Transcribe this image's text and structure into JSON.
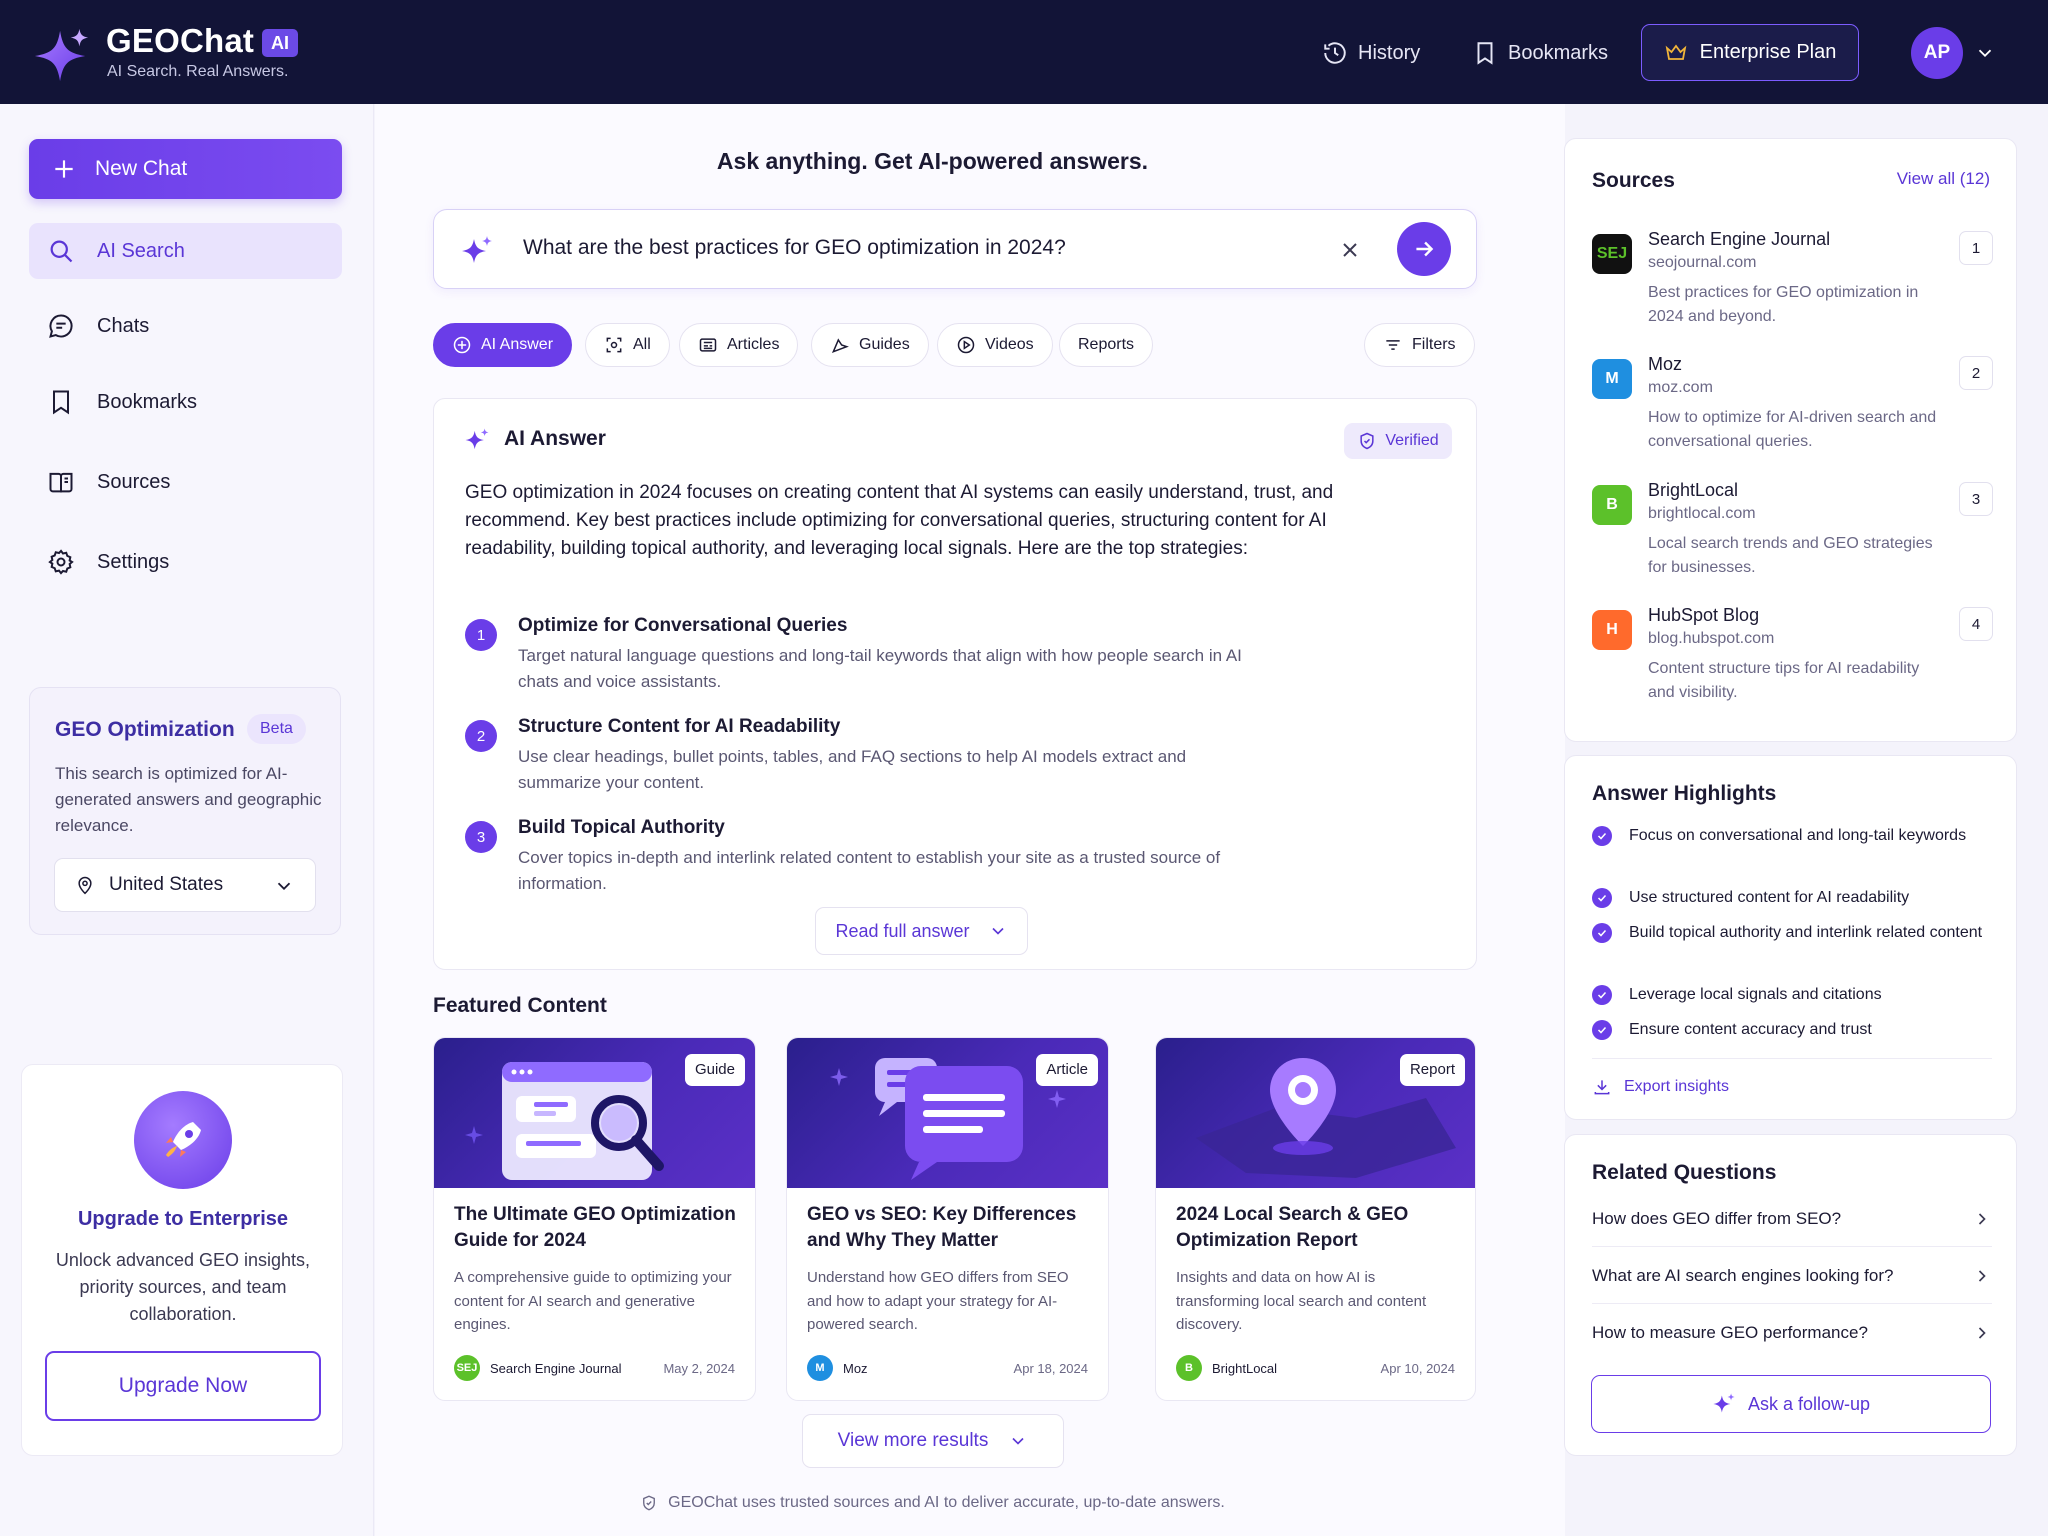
{
  "brand": {
    "name": "GEOChat",
    "badge": "AI",
    "tagline": "AI Search. Real Answers."
  },
  "topnav": {
    "history": "History",
    "bookmarks": "Bookmarks",
    "plan": "Enterprise Plan",
    "avatar_initials": "AP"
  },
  "sidebar": {
    "new_chat": "New Chat",
    "items": [
      {
        "label": "AI Search",
        "icon": "search-icon"
      },
      {
        "label": "Chats",
        "icon": "chat-icon"
      },
      {
        "label": "Bookmarks",
        "icon": "bookmark-icon"
      },
      {
        "label": "Sources",
        "icon": "book-icon"
      },
      {
        "label": "Settings",
        "icon": "gear-icon"
      }
    ],
    "geo": {
      "title": "GEO Optimization",
      "badge": "Beta",
      "description": "This search is optimized for AI-generated answers and geographic relevance.",
      "location": "United States"
    },
    "upgrade": {
      "title": "Upgrade to Enterprise",
      "description": "Unlock advanced GEO insights, priority sources, and team collaboration.",
      "button": "Upgrade Now"
    }
  },
  "main": {
    "headline": "Ask anything. Get AI-powered answers.",
    "search_query": "What are the best practices for GEO optimization in 2024?",
    "tabs": [
      {
        "label": "AI Answer",
        "active": true
      },
      {
        "label": "All"
      },
      {
        "label": "Articles"
      },
      {
        "label": "Guides"
      },
      {
        "label": "Videos"
      },
      {
        "label": "Reports"
      }
    ],
    "filters": "Filters",
    "answer": {
      "title": "AI Answer",
      "verified": "Verified",
      "intro": "GEO optimization in 2024 focuses on creating content that AI systems can easily understand, trust, and recommend. Key best practices include optimizing for conversational queries, structuring content for AI readability, building topical authority, and leveraging local signals. Here are the top strategies:",
      "points": [
        {
          "num": "1",
          "title": "Optimize for Conversational Queries",
          "desc": "Target natural language questions and long-tail keywords that align with how people search in AI chats and voice assistants."
        },
        {
          "num": "2",
          "title": "Structure Content for AI Readability",
          "desc": "Use clear headings, bullet points, tables, and FAQ sections to help AI models extract and summarize your content."
        },
        {
          "num": "3",
          "title": "Build Topical Authority",
          "desc": "Cover topics in-depth and interlink related content to establish your site as a trusted source of information."
        }
      ],
      "read_full": "Read full answer"
    },
    "featured_title": "Featured Content",
    "featured": [
      {
        "tag": "Guide",
        "title": "The Ultimate GEO Optimization Guide for 2024",
        "desc": "A comprehensive guide to optimizing your content for AI search and generative engines.",
        "source": "Search Engine Journal",
        "source_abbr": "SEJ",
        "date": "May 2, 2024",
        "color": "#5cc12a"
      },
      {
        "tag": "Article",
        "title": "GEO vs SEO: Key Differences and Why They Matter",
        "desc": "Understand how GEO differs from SEO and how to adapt your strategy for AI-powered search.",
        "source": "Moz",
        "source_abbr": "M",
        "date": "Apr 18, 2024",
        "color": "#1f8fe0"
      },
      {
        "tag": "Report",
        "title": "2024 Local Search & GEO Optimization Report",
        "desc": "Insights and data on how AI is transforming local search and content discovery.",
        "source": "BrightLocal",
        "source_abbr": "B",
        "date": "Apr 10, 2024",
        "color": "#5cc12a"
      }
    ],
    "view_more": "View more results",
    "footer_note": "GEOChat uses trusted sources and AI to deliver accurate, up-to-date answers."
  },
  "right": {
    "sources_title": "Sources",
    "view_all": "View all (12)",
    "sources": [
      {
        "idx": "1",
        "name": "Search Engine Journal",
        "domain": "seojournal.com",
        "desc": "Best practices for GEO optimization in 2024 and beyond.",
        "abbr": "SEJ",
        "color": "#111111"
      },
      {
        "idx": "2",
        "name": "Moz",
        "domain": "moz.com",
        "desc": "How to optimize for AI-driven search and conversational queries.",
        "abbr": "M",
        "color": "#1f8fe0"
      },
      {
        "idx": "3",
        "name": "BrightLocal",
        "domain": "brightlocal.com",
        "desc": "Local search trends and GEO strategies for businesses.",
        "abbr": "B",
        "color": "#5cc12a"
      },
      {
        "idx": "4",
        "name": "HubSpot Blog",
        "domain": "blog.hubspot.com",
        "desc": "Content structure tips for AI readability and visibility.",
        "abbr": "H",
        "color": "#ff6a2c"
      }
    ],
    "highlights_title": "Answer Highlights",
    "highlights": [
      "Focus on conversational and long-tail keywords",
      "Use structured content for AI readability",
      "Build topical authority and interlink related content",
      "Leverage local signals and citations",
      "Ensure content accuracy and trust"
    ],
    "export": "Export insights",
    "related_title": "Related Questions",
    "related": [
      "How does GEO differ from SEO?",
      "What are AI search engines looking for?",
      "How to measure GEO performance?"
    ],
    "followup": "Ask a follow-up"
  }
}
